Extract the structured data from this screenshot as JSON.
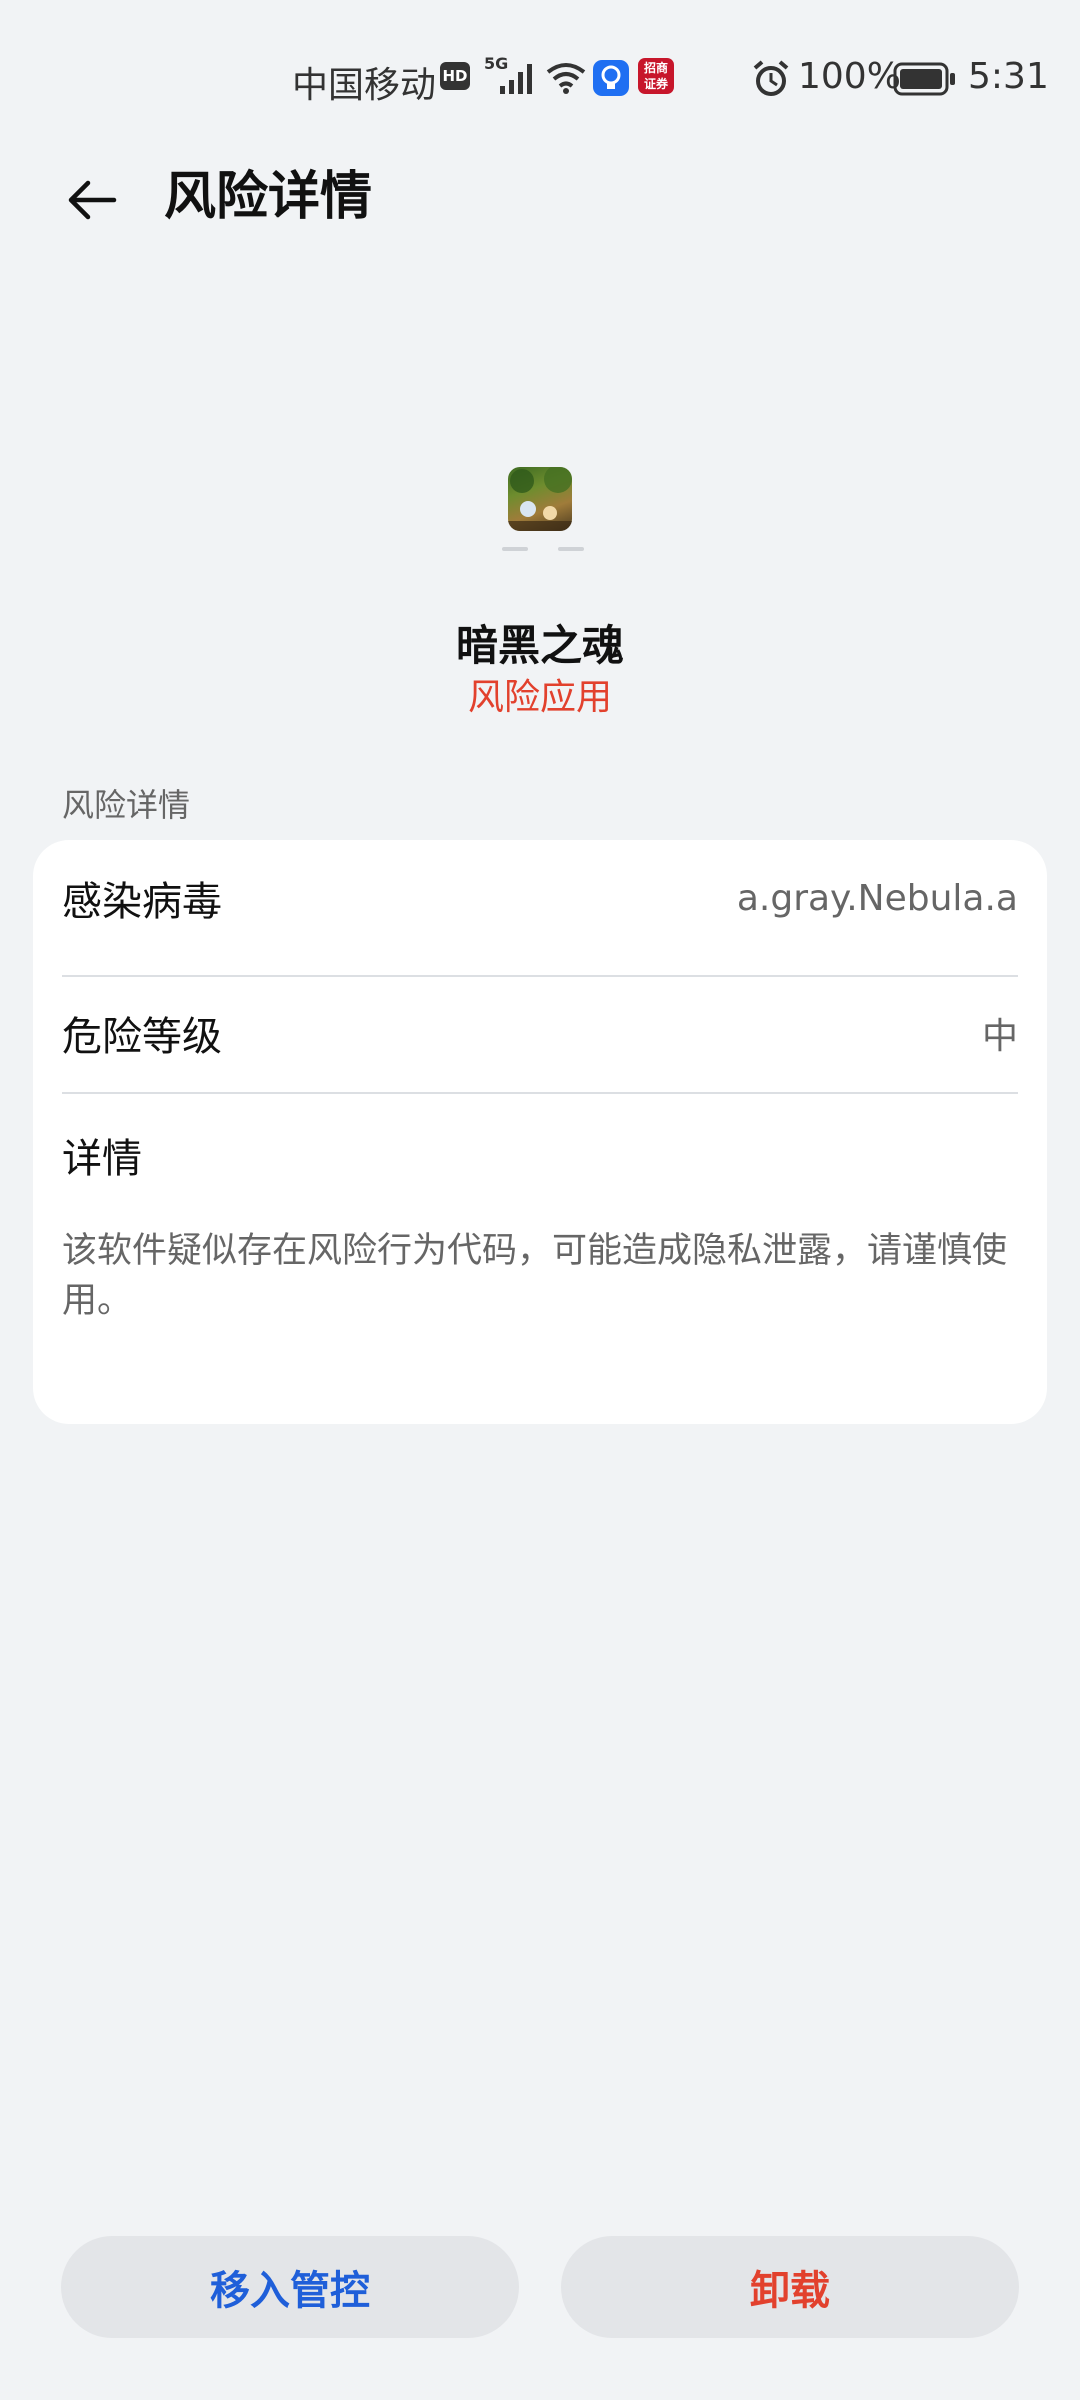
{
  "status_bar": {
    "carrier": "中国移动",
    "hd": "HD",
    "network": "5G",
    "battery": "100%",
    "time": "5:31",
    "icons": [
      "hd-icon",
      "signal-icon",
      "wifi-icon",
      "bulb-icon",
      "zhaoshang-app-icon",
      "alarm-icon",
      "battery-icon"
    ]
  },
  "header": {
    "title": "风险详情",
    "back_icon": "arrow-left-icon"
  },
  "app": {
    "name": "暗黑之魂",
    "status": "风险应用"
  },
  "section": {
    "label": "风险详情",
    "rows": [
      {
        "label": "感染病毒",
        "value": "a.gray.Nebula.a"
      },
      {
        "label": "危险等级",
        "value": "中"
      }
    ],
    "details_heading": "详情",
    "details_text": "该软件疑似存在风险行为代码，可能造成隐私泄露，请谨慎使用。"
  },
  "actions": {
    "control_label": "移入管控",
    "uninstall_label": "卸载"
  },
  "colors": {
    "background": "#f1f3f5",
    "danger": "#e2412d",
    "accent": "#1f5fd9"
  }
}
